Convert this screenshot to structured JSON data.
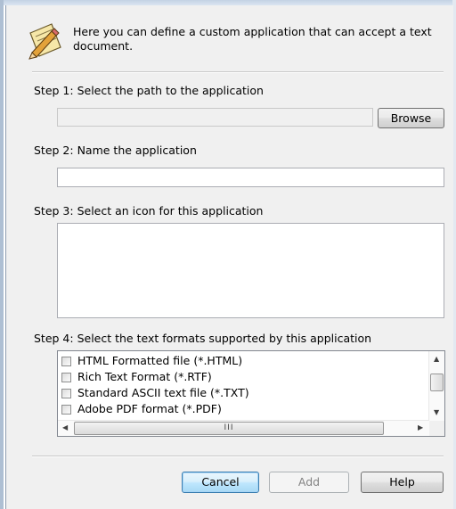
{
  "header": {
    "description": "Here you can define a custom application that can accept a text document.",
    "icon": "pencil-notepad-icon"
  },
  "step1": {
    "label": "Step 1: Select the path to the application",
    "path_value": "",
    "browse_label": "Browse"
  },
  "step2": {
    "label": "Step 2: Name the application",
    "name_value": ""
  },
  "step3": {
    "label": "Step 3: Select an icon for this application"
  },
  "step4": {
    "label": "Step 4: Select the text formats supported by this application",
    "formats": [
      {
        "label": "HTML Formatted file (*.HTML)",
        "checked": false
      },
      {
        "label": "Rich Text Format (*.RTF)",
        "checked": false
      },
      {
        "label": "Standard ASCII text file (*.TXT)",
        "checked": false
      },
      {
        "label": "Adobe PDF format (*.PDF)",
        "checked": false
      }
    ],
    "hscroll_grip": "III"
  },
  "footer": {
    "cancel_label": "Cancel",
    "add_label": "Add",
    "help_label": "Help"
  },
  "colors": {
    "dialog_bg": "#f0f0f0",
    "default_button_border": "#3c7fb1",
    "window_frame": "#aebfd3"
  }
}
